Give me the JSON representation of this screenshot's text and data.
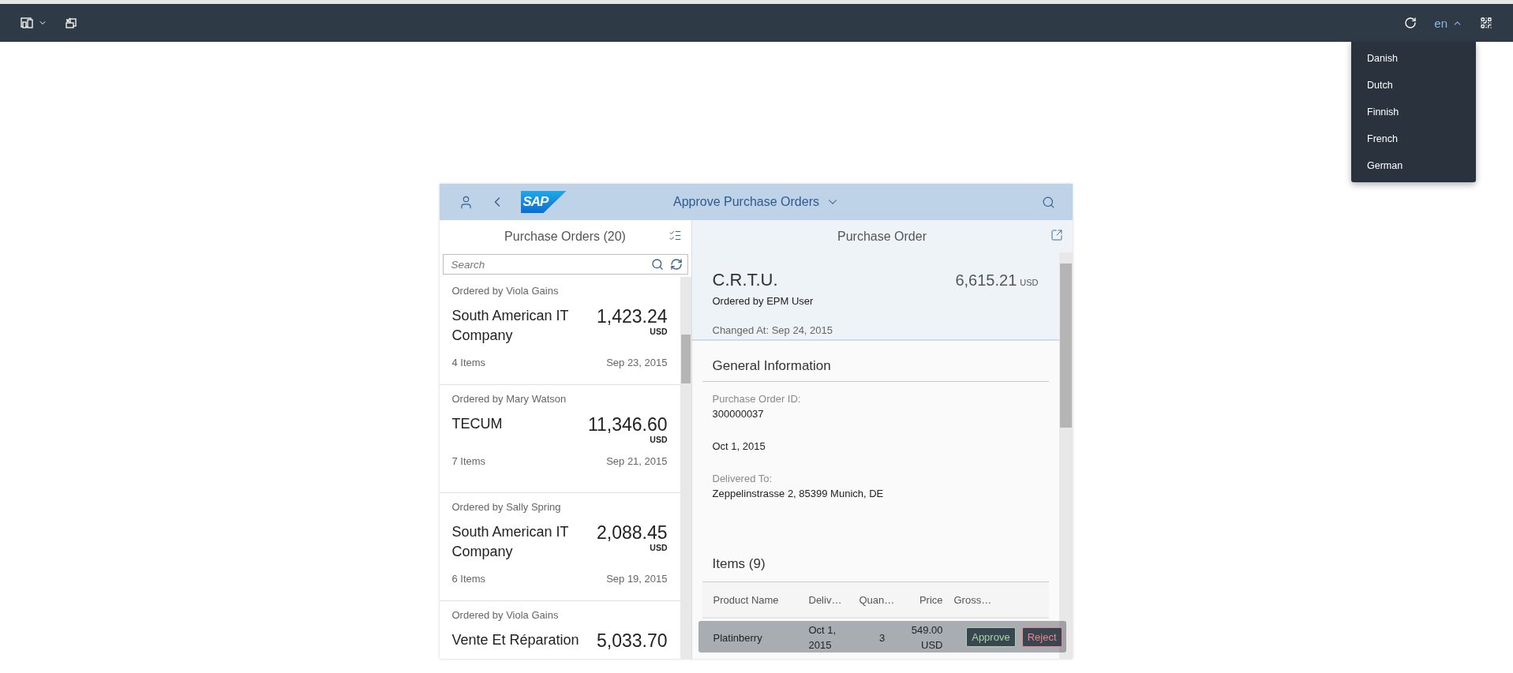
{
  "topbar": {
    "language": {
      "value": "en",
      "expanded": true,
      "options": [
        "Danish",
        "Dutch",
        "Finnish",
        "French",
        "German"
      ]
    }
  },
  "app": {
    "logo": "SAP",
    "title": "Approve Purchase Orders",
    "master": {
      "title": "Purchase Orders (20)",
      "search": {
        "placeholder": "Search"
      },
      "orders": [
        {
          "ordered_by": "Ordered by Viola Gains",
          "name": "South American IT Company",
          "amount": "1,423.24",
          "currency": "USD",
          "items": "4 Items",
          "date": "Sep 23, 2015"
        },
        {
          "ordered_by": "Ordered by Mary Watson",
          "name": "TECUM",
          "amount": "11,346.60",
          "currency": "USD",
          "items": "7 Items",
          "date": "Sep 21, 2015"
        },
        {
          "ordered_by": "Ordered by Sally Spring",
          "name": "South American IT Company",
          "amount": "2,088.45",
          "currency": "USD",
          "items": "6 Items",
          "date": "Sep 19, 2015"
        },
        {
          "ordered_by": "Ordered by Viola Gains",
          "name": "Vente Et Réparation",
          "amount": "5,033.70"
        }
      ]
    },
    "detail": {
      "title": "Purchase Order",
      "header": {
        "name": "C.R.T.U.",
        "amount": "6,615.21",
        "currency": "USD",
        "ordered_by": "Ordered by EPM User",
        "changed_at": "Changed At: Sep 24, 2015"
      },
      "general_information": {
        "title": "General Information",
        "fields": [
          {
            "label": "Purchase Order ID:",
            "value": "300000037"
          },
          {
            "value": "Oct 1, 2015"
          },
          {
            "label": "Delivered To:",
            "value": "Zeppelinstrasse 2, 85399 Munich, DE"
          }
        ]
      },
      "items": {
        "title": "Items (9)",
        "columns": [
          "Product Name",
          "Deliv…",
          "Quan…",
          "Price",
          "Gross…"
        ],
        "rows": [
          [
            "Platinberry",
            "Oct 1, 2015",
            "3",
            "549.00 USD",
            ""
          ]
        ]
      },
      "footer": [
        {
          "label": "Approve",
          "kind": "accept"
        },
        {
          "label": "Reject",
          "kind": "reject"
        }
      ]
    }
  }
}
